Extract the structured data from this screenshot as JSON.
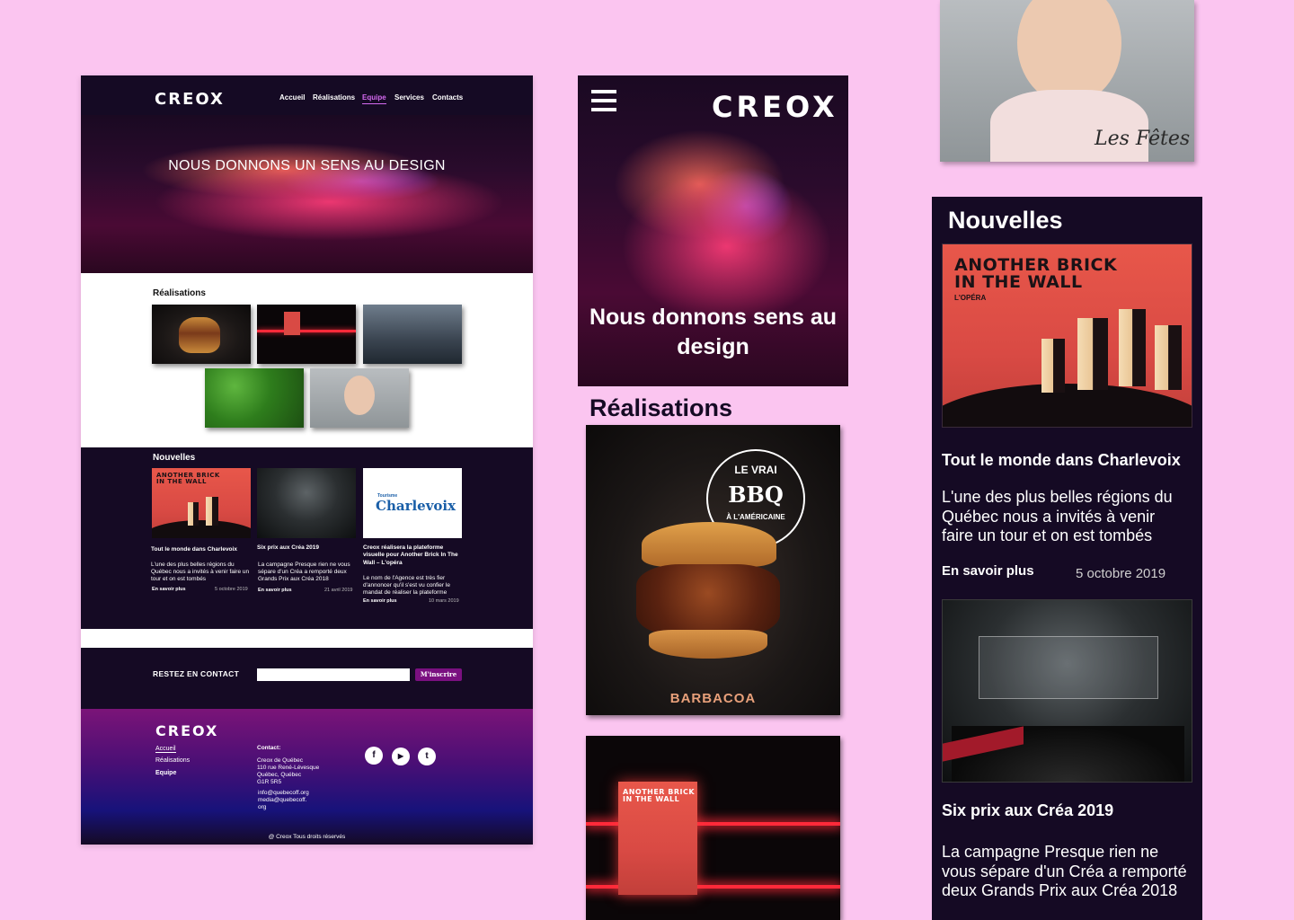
{
  "desktop": {
    "logo": "CREOX",
    "nav": [
      "Accueil",
      "Réalisations",
      "Equipe",
      "Services",
      "Contacts"
    ],
    "active_nav": "Equipe",
    "hero_title": "NOUS  DONNONS UN SENS AU DESIGN",
    "realisations_title": "Réalisations",
    "news_title": "Nouvelles",
    "news": [
      {
        "title": "Tout le monde dans Charlevoix",
        "text": "L'une des plus belles régions du Québec nous a invités à venir faire un tour et on est tombés",
        "more": "En savoir plus",
        "date": "5 octobre 2019"
      },
      {
        "title": "Six prix aux Créa 2019",
        "text": "La campagne Presque rien ne vous sépare d'un Créa a remporté deux Grands Prix aux Créa 2018",
        "more": "En savoir plus",
        "date": "21 avril 2019"
      },
      {
        "title": "Creox réalisera la plateforme visuelle pour Another Brick In The Wall – L'opéra",
        "text": "Le nom de l'Agence est très fier d'annoncer qu'il s'est vu confier le mandat de réaliser la plateforme",
        "more": "En savoir plus",
        "date": "10 mars 2019"
      }
    ],
    "charlevoix_small": "Tourisme",
    "charlevoix_big": "Charlevoix",
    "contact_label": "RESTEZ EN CONTACT",
    "subscribe": "M'inscrire",
    "footer": {
      "logo": "CREOX",
      "links": [
        "Accueil",
        "Réalisations",
        "Equipe"
      ],
      "contact_label": "Contact:",
      "address": [
        "Creox de Québec",
        "110 rue René-Lévesque",
        "Québec, Québec",
        "G1R 5R5"
      ],
      "emails": [
        "info@quebecoff.org",
        "media@quebecoff.",
        "org"
      ],
      "copyright": "@ Creox Tous droits réservés",
      "social": [
        "f",
        "▶",
        "t"
      ]
    }
  },
  "mobile": {
    "logo": "CREOX",
    "hero_title": "Nous donnons sens au design",
    "realisations_title": "Réalisations",
    "bbq_badge": [
      "LE VRAI",
      "BBQ",
      "À L'AMÉRICAINE"
    ],
    "barbacoa": "BARBACOA"
  },
  "right": {
    "fetes": "Les Fêtes",
    "news_title": "Nouvelles",
    "items": [
      {
        "title": "Tout le monde dans Charlevoix",
        "text": "L'une des plus belles régions du Québec nous a invités à venir faire un tour et on est tombés",
        "more": "En savoir plus",
        "date": "5 octobre 2019"
      },
      {
        "title": "Six prix aux Créa 2019",
        "text": "La campagne Presque rien ne vous sépare d'un Créa a remporté deux Grands Prix aux Créa 2018"
      }
    ]
  },
  "poster": {
    "line1": "ANOTHER BRICK",
    "line2": "IN THE WALL",
    "line3": "L'OPÉRA"
  },
  "colors": {
    "background": "#fbc5f0",
    "dark": "#150a24",
    "accent": "#d56af0",
    "button": "#7a1080"
  }
}
